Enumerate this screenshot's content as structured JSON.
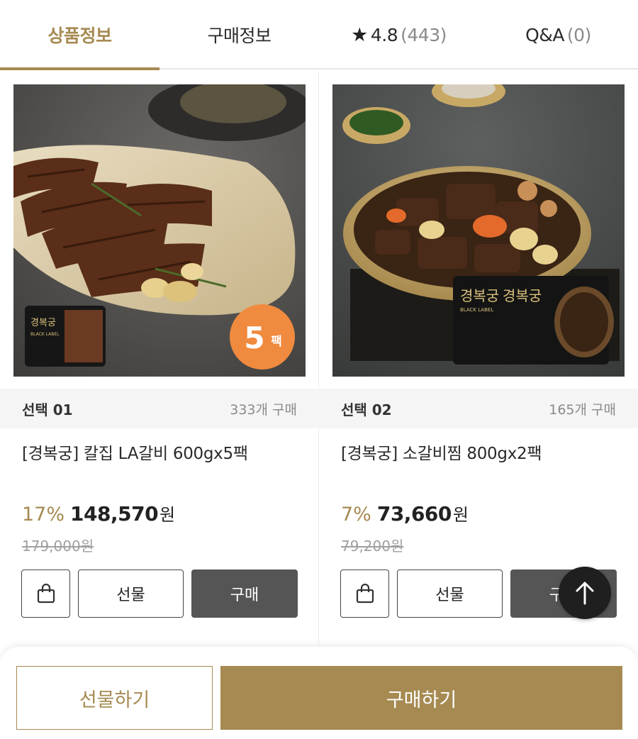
{
  "tabs": [
    {
      "label": "상품정보",
      "active": true
    },
    {
      "label": "구매정보",
      "active": false
    },
    {
      "label": "★",
      "rating": "4.8",
      "count": "(443)",
      "active": false
    },
    {
      "label": "Q&A",
      "count": "(0)",
      "active": false
    }
  ],
  "products": [
    {
      "select": "선택 01",
      "bought": "333개 구매",
      "title": "[경복궁] 칼집 LA갈비 600gx5팩",
      "discount": "17%",
      "price": "148,570",
      "currency": "원",
      "original_price": "179,000원",
      "badge": {
        "number": "5",
        "unit": "팩"
      },
      "package_brand": "경복궁",
      "package_sub": "BLACK LABEL",
      "buttons": {
        "gift": "선물",
        "buy": "구매"
      }
    },
    {
      "select": "선택 02",
      "bought": "165개 구매",
      "title": "[경복궁] 소갈비찜 800gx2팩",
      "discount": "7%",
      "price": "73,660",
      "currency": "원",
      "original_price": "79,200원",
      "package_brand_left": "경복궁",
      "package_brand_right": "경복궁",
      "package_sub": "BLACK LABEL",
      "buttons": {
        "gift": "선물",
        "buy": "구매"
      }
    }
  ],
  "bottom": {
    "gift_label": "선물하기",
    "buy_label": "구매하기"
  },
  "colors": {
    "accent": "#a68a52",
    "buy_button": "#555555",
    "scroll_top": "#1f1f1f",
    "badge": "#f08a3e"
  },
  "icons": {
    "bag": "shopping-bag-icon",
    "star": "star-icon",
    "scroll_top": "arrow-up-icon"
  }
}
